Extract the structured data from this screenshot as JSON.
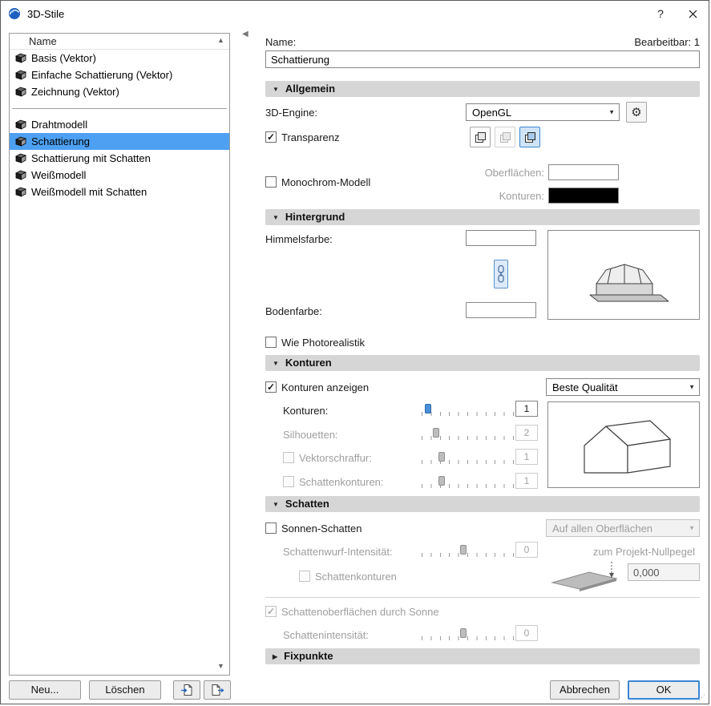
{
  "window": {
    "title": "3D-Stile",
    "help_label": "?"
  },
  "list": {
    "header": "Name",
    "groups": [
      [
        "Basis (Vektor)",
        "Einfache Schattierung (Vektor)",
        "Zeichnung (Vektor)"
      ],
      [
        "Drahtmodell",
        "Schattierung",
        "Schattierung mit Schatten",
        "Weißmodell",
        "Weißmodell mit Schatten"
      ]
    ],
    "selected": "Schattierung",
    "new_label": "Neu...",
    "delete_label": "Löschen"
  },
  "header": {
    "name_label": "Name:",
    "editable_label": "Bearbeitbar: 1",
    "name_value": "Schattierung"
  },
  "sections": {
    "allgemein": "Allgemein",
    "hintergrund": "Hintergrund",
    "konturen": "Konturen",
    "schatten": "Schatten",
    "fixpunkte": "Fixpunkte"
  },
  "allgemein": {
    "engine_label": "3D-Engine:",
    "engine_value": "OpenGL"
  },
  "checks": {
    "transparenz": {
      "label": "Transparenz",
      "checked": true,
      "enabled": true
    },
    "monochrom": {
      "label": "Monochrom-Modell",
      "checked": false,
      "enabled": true
    },
    "wie_photo": {
      "label": "Wie Photorealistik",
      "checked": false,
      "enabled": true
    },
    "konturen_anzeigen": {
      "label": "Konturen anzeigen",
      "checked": true,
      "enabled": true
    },
    "vektorschraffur": {
      "label": "Vektorschraffur:",
      "checked": false,
      "enabled": false
    },
    "schattenkonturen1": {
      "label": "Schattenkonturen:",
      "checked": false,
      "enabled": false
    },
    "sonnen_schatten": {
      "label": "Sonnen-Schatten",
      "checked": false,
      "enabled": true
    },
    "schattenkonturen2": {
      "label": "Schattenkonturen",
      "checked": false,
      "enabled": false
    },
    "schattenoberflaechen": {
      "label": "Schattenoberflächen durch Sonne",
      "checked": true,
      "enabled": false
    }
  },
  "swatches": {
    "oberflaechen_label": "Oberflächen:",
    "oberflaechen_color": "#ffffff",
    "konturen_label": "Konturen:",
    "konturen_color": "#000000"
  },
  "hintergrund": {
    "himmel_label": "Himmelsfarbe:",
    "himmel_color": "#ffffff",
    "boden_label": "Bodenfarbe:",
    "boden_color": "#ffffff"
  },
  "konturen": {
    "qualitaet_value": "Beste Qualität"
  },
  "sliders": {
    "konturen": {
      "label": "Konturen:",
      "value": "1",
      "pct": 7,
      "enabled": true
    },
    "silhouetten": {
      "label": "Silhouetten:",
      "value": "2",
      "pct": 16,
      "enabled": false
    },
    "vektorschraffur": {
      "value": "1",
      "pct": 22,
      "enabled": false
    },
    "schattenkonturen": {
      "value": "1",
      "pct": 22,
      "enabled": false
    },
    "schattenwurf": {
      "label": "Schattenwurf-Intensität:",
      "value": "0",
      "pct": 45,
      "enabled": false
    },
    "schattenintensitaet": {
      "label": "Schattenintensität:",
      "value": "0",
      "pct": 45,
      "enabled": false
    }
  },
  "schatten": {
    "dropdown_value": "Auf allen Oberflächen",
    "nullpegel_label": "zum Projekt-Nullpegel",
    "nullpegel_value": "0,000"
  },
  "footer": {
    "cancel_label": "Abbrechen",
    "ok_label": "OK"
  }
}
